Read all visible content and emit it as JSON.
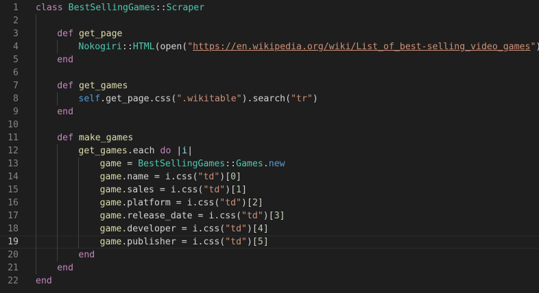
{
  "editor": {
    "current_line": 19,
    "lines": [
      {
        "n": "1",
        "indent": 0,
        "tokens": [
          [
            "kw",
            "class"
          ],
          [
            "plain",
            " "
          ],
          [
            "cls",
            "BestSellingGames"
          ],
          [
            "op",
            "::"
          ],
          [
            "cls",
            "Scraper"
          ]
        ]
      },
      {
        "n": "2",
        "indent": 1,
        "tokens": []
      },
      {
        "n": "3",
        "indent": 1,
        "tokens": [
          [
            "kw",
            "def"
          ],
          [
            "plain",
            " "
          ],
          [
            "fn",
            "get_page"
          ]
        ]
      },
      {
        "n": "4",
        "indent": 2,
        "tokens": [
          [
            "cls",
            "Nokogiri"
          ],
          [
            "op",
            "::"
          ],
          [
            "cls",
            "HTML"
          ],
          [
            "plain",
            "(open("
          ],
          [
            "str",
            "\""
          ],
          [
            "url",
            "https://en.wikipedia.org/wiki/List_of_best-selling_video_games"
          ],
          [
            "str",
            "\""
          ],
          [
            "plain",
            "))"
          ]
        ]
      },
      {
        "n": "5",
        "indent": 1,
        "tokens": [
          [
            "kw",
            "end"
          ]
        ]
      },
      {
        "n": "6",
        "indent": 1,
        "tokens": []
      },
      {
        "n": "7",
        "indent": 1,
        "tokens": [
          [
            "kw",
            "def"
          ],
          [
            "plain",
            " "
          ],
          [
            "fn",
            "get_games"
          ]
        ]
      },
      {
        "n": "8",
        "indent": 2,
        "tokens": [
          [
            "self",
            "self"
          ],
          [
            "plain",
            ".get_page.css("
          ],
          [
            "str",
            "\".wikitable\""
          ],
          [
            "plain",
            ").search("
          ],
          [
            "str",
            "\"tr\""
          ],
          [
            "plain",
            ")"
          ]
        ]
      },
      {
        "n": "9",
        "indent": 1,
        "tokens": [
          [
            "kw",
            "end"
          ]
        ]
      },
      {
        "n": "10",
        "indent": 1,
        "tokens": []
      },
      {
        "n": "11",
        "indent": 1,
        "tokens": [
          [
            "kw",
            "def"
          ],
          [
            "plain",
            " "
          ],
          [
            "fn",
            "make_games"
          ]
        ]
      },
      {
        "n": "12",
        "indent": 2,
        "tokens": [
          [
            "fn",
            "get_games"
          ],
          [
            "plain",
            ".each "
          ],
          [
            "kw",
            "do"
          ],
          [
            "plain",
            " |"
          ],
          [
            "var",
            "i"
          ],
          [
            "plain",
            "|"
          ]
        ]
      },
      {
        "n": "13",
        "indent": 3,
        "tokens": [
          [
            "fn",
            "game"
          ],
          [
            "plain",
            " = "
          ],
          [
            "cls",
            "BestSellingGames"
          ],
          [
            "op",
            "::"
          ],
          [
            "cls",
            "Games"
          ],
          [
            "plain",
            "."
          ],
          [
            "self",
            "new"
          ]
        ]
      },
      {
        "n": "14",
        "indent": 3,
        "tokens": [
          [
            "fn",
            "game"
          ],
          [
            "plain",
            ".name = i.css("
          ],
          [
            "str",
            "\"td\""
          ],
          [
            "plain",
            ")["
          ],
          [
            "num",
            "0"
          ],
          [
            "plain",
            "]"
          ]
        ]
      },
      {
        "n": "15",
        "indent": 3,
        "tokens": [
          [
            "fn",
            "game"
          ],
          [
            "plain",
            ".sales = i.css("
          ],
          [
            "str",
            "\"td\""
          ],
          [
            "plain",
            ")["
          ],
          [
            "num",
            "1"
          ],
          [
            "plain",
            "]"
          ]
        ]
      },
      {
        "n": "16",
        "indent": 3,
        "tokens": [
          [
            "fn",
            "game"
          ],
          [
            "plain",
            ".platform = i.css("
          ],
          [
            "str",
            "\"td\""
          ],
          [
            "plain",
            ")["
          ],
          [
            "num",
            "2"
          ],
          [
            "plain",
            "]"
          ]
        ]
      },
      {
        "n": "17",
        "indent": 3,
        "tokens": [
          [
            "fn",
            "game"
          ],
          [
            "plain",
            ".release_date = i.css("
          ],
          [
            "str",
            "\"td\""
          ],
          [
            "plain",
            ")["
          ],
          [
            "num",
            "3"
          ],
          [
            "plain",
            "]"
          ]
        ]
      },
      {
        "n": "18",
        "indent": 3,
        "tokens": [
          [
            "fn",
            "game"
          ],
          [
            "plain",
            ".developer = i.css("
          ],
          [
            "str",
            "\"td\""
          ],
          [
            "plain",
            ")["
          ],
          [
            "num",
            "4"
          ],
          [
            "plain",
            "]"
          ]
        ]
      },
      {
        "n": "19",
        "indent": 3,
        "tokens": [
          [
            "fn",
            "game"
          ],
          [
            "plain",
            ".publisher = i.css("
          ],
          [
            "str",
            "\"td\""
          ],
          [
            "plain",
            ")["
          ],
          [
            "num",
            "5"
          ],
          [
            "plain",
            "]"
          ]
        ]
      },
      {
        "n": "20",
        "indent": 2,
        "tokens": [
          [
            "kw",
            "end"
          ]
        ]
      },
      {
        "n": "21",
        "indent": 1,
        "tokens": [
          [
            "kw",
            "end"
          ]
        ]
      },
      {
        "n": "22",
        "indent": 0,
        "tokens": [
          [
            "kw",
            "end"
          ]
        ]
      }
    ]
  }
}
